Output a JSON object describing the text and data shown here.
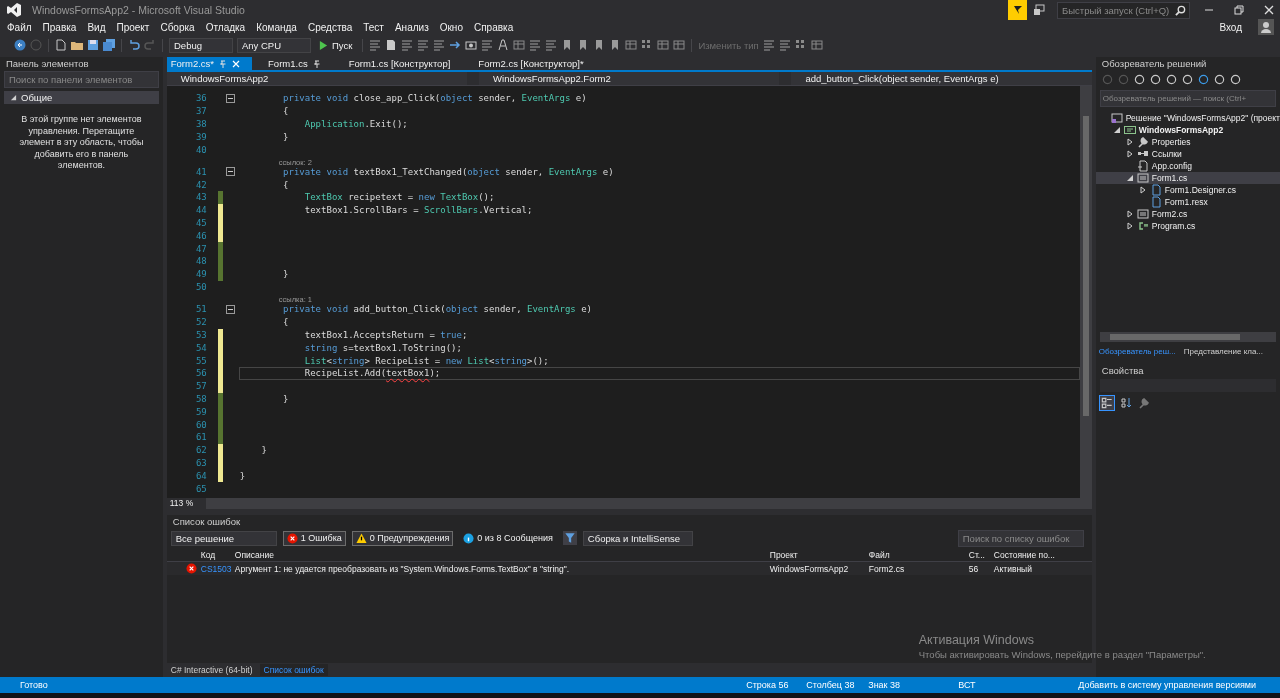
{
  "window": {
    "title": "WindowsFormsApp2 - Microsoft Visual Studio",
    "quick_launch": {
      "placeholder": "Быстрый запуск (Ctrl+Q)"
    },
    "sign_in": "Вход"
  },
  "menu": [
    "Файл",
    "Правка",
    "Вид",
    "Проект",
    "Сборка",
    "Отладка",
    "Команда",
    "Средства",
    "Тест",
    "Анализ",
    "Окно",
    "Справка"
  ],
  "toolbar": {
    "configuration": "Debug",
    "platform": "Any CPU",
    "start": "Пуск",
    "change_type": "Изменить тип"
  },
  "toolbox": {
    "title": "Панель элементов",
    "search": {
      "placeholder": "Поиск по панели элементов"
    },
    "group": {
      "label": "Общие",
      "expanded": true
    },
    "empty_text": "В этой группе нет элементов управления. Перетащите элемент в эту область, чтобы добавить его в панель элементов."
  },
  "doc_tabs": [
    {
      "label": "Form2.cs*",
      "selected": true,
      "pinned": true
    },
    {
      "label": "Form1.cs",
      "selected": false,
      "pinned": true
    },
    {
      "label": "Form1.cs [Конструктор]",
      "selected": false,
      "pinned": false
    },
    {
      "label": "Form2.cs [Конструктор]*",
      "selected": false,
      "pinned": false
    }
  ],
  "nav_bar": [
    "WindowsFormsApp2",
    "WindowsFormsApp2.Form2",
    "add_button_Click(object sender, EventArgs e)"
  ],
  "editor": {
    "zoom": "113 %",
    "lines": [
      {
        "n": "36",
        "fold": true,
        "modified": false,
        "segments": [
          {
            "t": "        private void ",
            "kind": "kw"
          },
          {
            "t": "close_app_Click(",
            "kind": "text"
          },
          {
            "t": "object",
            "kind": "kw"
          },
          {
            "t": " sender, ",
            "kind": "text"
          },
          {
            "t": "EventArgs",
            "kind": "type"
          },
          {
            "t": " e)",
            "kind": "text"
          }
        ]
      },
      {
        "n": "37",
        "modified": false,
        "segments": [
          {
            "t": "        {",
            "kind": "text"
          }
        ]
      },
      {
        "n": "38",
        "modified": false,
        "segments": [
          {
            "t": "            Application",
            "kind": "type"
          },
          {
            "t": ".Exit();",
            "kind": "text"
          }
        ]
      },
      {
        "n": "39",
        "modified": false,
        "segments": [
          {
            "t": "        }",
            "kind": "text"
          }
        ]
      },
      {
        "n": "40",
        "modified": false
      },
      {
        "n": "41",
        "fold": true,
        "modified": false,
        "codelens": "ссылок: 2",
        "segments": [
          {
            "t": "        private void ",
            "kind": "kw"
          },
          {
            "t": "textBox1_TextChanged(",
            "kind": "text"
          },
          {
            "t": "object",
            "kind": "kw"
          },
          {
            "t": " sender, ",
            "kind": "text"
          },
          {
            "t": "EventArgs",
            "kind": "type"
          },
          {
            "t": " e)",
            "kind": "text"
          }
        ]
      },
      {
        "n": "42",
        "modified": false,
        "segments": [
          {
            "t": "        {",
            "kind": "text"
          }
        ]
      },
      {
        "n": "43",
        "modified": true,
        "saved": true,
        "segments": [
          {
            "t": "            TextBox",
            "kind": "type"
          },
          {
            "t": " recipetext = ",
            "kind": "text"
          },
          {
            "t": "new ",
            "kind": "kw"
          },
          {
            "t": "TextBox",
            "kind": "type"
          },
          {
            "t": "();",
            "kind": "text"
          }
        ]
      },
      {
        "n": "44",
        "modified": true,
        "saved": false,
        "segments": [
          {
            "t": "            textBox1.ScrollBars = ",
            "kind": "text"
          },
          {
            "t": "ScrollBars",
            "kind": "type"
          },
          {
            "t": ".Vertical;",
            "kind": "text"
          }
        ]
      },
      {
        "n": "45",
        "modified": true,
        "saved": false
      },
      {
        "n": "46",
        "modified": true,
        "saved": false
      },
      {
        "n": "47",
        "modified": true,
        "saved": true
      },
      {
        "n": "48",
        "modified": true,
        "saved": true
      },
      {
        "n": "49",
        "modified": true,
        "saved": true,
        "segments": [
          {
            "t": "        }",
            "kind": "text"
          }
        ]
      },
      {
        "n": "50",
        "modified": false
      },
      {
        "n": "51",
        "fold": true,
        "modified": false,
        "codelens": "ссылка: 1",
        "segments": [
          {
            "t": "        private void ",
            "kind": "kw"
          },
          {
            "t": "add_button_Click(",
            "kind": "text"
          },
          {
            "t": "object",
            "kind": "kw"
          },
          {
            "t": " sender, ",
            "kind": "text"
          },
          {
            "t": "EventArgs",
            "kind": "type"
          },
          {
            "t": " e)",
            "kind": "text"
          }
        ]
      },
      {
        "n": "52",
        "modified": false,
        "segments": [
          {
            "t": "        {",
            "kind": "text"
          }
        ]
      },
      {
        "n": "53",
        "modified": true,
        "saved": false,
        "segments": [
          {
            "t": "            textBox1.AcceptsReturn = ",
            "kind": "text"
          },
          {
            "t": "true",
            "kind": "kw"
          },
          {
            "t": ";",
            "kind": "text"
          }
        ]
      },
      {
        "n": "54",
        "modified": true,
        "saved": false,
        "segments": [
          {
            "t": "            string",
            "kind": "kw"
          },
          {
            "t": " s=textBox1.ToString();",
            "kind": "text"
          }
        ]
      },
      {
        "n": "55",
        "modified": true,
        "saved": false,
        "segments": [
          {
            "t": "            List",
            "kind": "type"
          },
          {
            "t": "<",
            "kind": "text"
          },
          {
            "t": "string",
            "kind": "kw"
          },
          {
            "t": "> RecipeList = ",
            "kind": "text"
          },
          {
            "t": "new ",
            "kind": "kw"
          },
          {
            "t": "List",
            "kind": "type"
          },
          {
            "t": "<",
            "kind": "text"
          },
          {
            "t": "string",
            "kind": "kw"
          },
          {
            "t": ">();",
            "kind": "text"
          }
        ]
      },
      {
        "n": "56",
        "modified": true,
        "saved": false,
        "current": true,
        "segments": [
          {
            "t": "            RecipeList.Add(",
            "kind": "text"
          },
          {
            "t": "textBox1",
            "kind": "text",
            "error": true
          },
          {
            "t": ");",
            "kind": "text"
          }
        ]
      },
      {
        "n": "57",
        "modified": true,
        "saved": false
      },
      {
        "n": "58",
        "modified": true,
        "saved": true,
        "segments": [
          {
            "t": "        }",
            "kind": "text"
          }
        ]
      },
      {
        "n": "59",
        "modified": true,
        "saved": true
      },
      {
        "n": "60",
        "modified": true,
        "saved": true
      },
      {
        "n": "61",
        "modified": true,
        "saved": true
      },
      {
        "n": "62",
        "modified": true,
        "saved": false,
        "segments": [
          {
            "t": "    }",
            "kind": "text"
          }
        ]
      },
      {
        "n": "63",
        "modified": true,
        "saved": false
      },
      {
        "n": "64",
        "modified": true,
        "saved": false,
        "segments": [
          {
            "t": "}",
            "kind": "text"
          }
        ]
      },
      {
        "n": "65",
        "modified": false
      }
    ]
  },
  "solution_explorer": {
    "title": "Обозреватель решений",
    "search": {
      "placeholder": "Обозреватель решений — поиск (Ctrl+"
    },
    "tree": [
      {
        "label": "Решение \"WindowsFormsApp2\"  (проект",
        "kind": "solution",
        "selected": false,
        "children": [
          {
            "label": "WindowsFormsApp2",
            "kind": "project",
            "selected": false,
            "expanded": true,
            "children": [
              {
                "label": "Properties",
                "kind": "properties",
                "selected": false,
                "expanded": false
              },
              {
                "label": "Ссылки",
                "kind": "references",
                "selected": false,
                "expanded": false
              },
              {
                "label": "App.config",
                "kind": "config",
                "selected": false
              },
              {
                "label": "Form1.cs",
                "kind": "form",
                "selected": true,
                "expanded": true,
                "children": [
                  {
                    "label": "Form1.Designer.cs",
                    "kind": "file",
                    "selected": false,
                    "expanded": false
                  },
                  {
                    "label": "Form1.resx",
                    "kind": "file",
                    "selected": false
                  }
                ]
              },
              {
                "label": "Form2.cs",
                "kind": "form",
                "selected": false,
                "expanded": false
              },
              {
                "label": "Program.cs",
                "kind": "csharp",
                "selected": false,
                "expanded": false
              }
            ]
          }
        ]
      }
    ],
    "tabs": [
      {
        "label": "Обозреватель реш...",
        "selected": true
      },
      {
        "label": "Представление кла...",
        "selected": false
      }
    ]
  },
  "properties": {
    "title": "Свойства"
  },
  "error_list": {
    "title": "Список ошибок",
    "scope": "Все решение",
    "filters": [
      {
        "label": "1 Ошибка",
        "kind": "error",
        "selected": true
      },
      {
        "label": "0 Предупреждения",
        "kind": "warning",
        "selected": true
      },
      {
        "label": "0 из 8 Сообщения",
        "kind": "message",
        "selected": false
      }
    ],
    "source": "Сборка и IntelliSense",
    "search": {
      "placeholder": "Поиск по списку ошибок"
    },
    "columns": [
      "Код",
      "Описание",
      "Проект",
      "Файл",
      "Ст...",
      "Состояние по..."
    ],
    "rows": [
      {
        "kind": "error",
        "code": "CS1503",
        "description": "Аргумент 1: не удается преобразовать из \"System.Windows.Forms.TextBox\" в \"string\".",
        "project": "WindowsFormsApp2",
        "file": "Form2.cs",
        "line": "56",
        "state": "Активный"
      }
    ]
  },
  "bottom_tabs": [
    {
      "label": "C# Interactive (64-bit)",
      "selected": false
    },
    {
      "label": "Список ошибок",
      "selected": true
    }
  ],
  "activation": {
    "title": "Активация Windows",
    "text": "Чтобы активировать Windows, перейдите в раздел \"Параметры\"."
  },
  "status_bar": {
    "state": "Готово",
    "line": "Строка 56",
    "column": "Столбец 38",
    "char": "Знак 38",
    "mode": "ВСТ",
    "source_control": "Добавить в систему управления версиями"
  }
}
